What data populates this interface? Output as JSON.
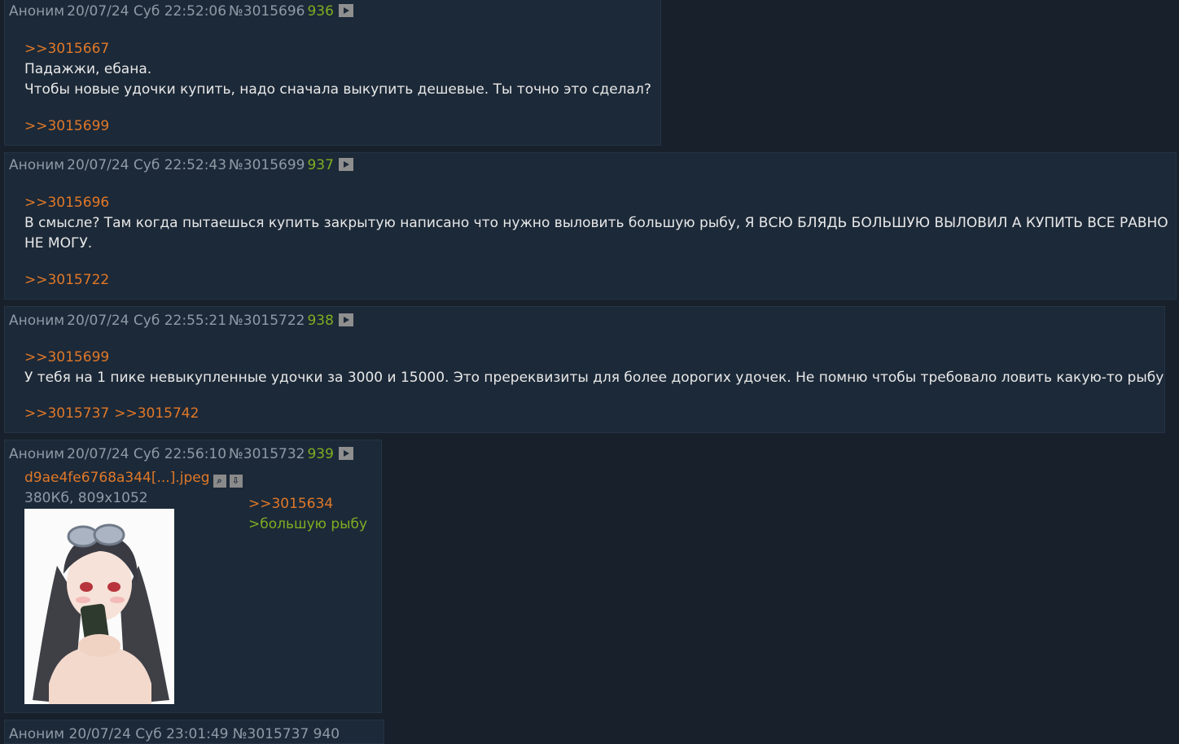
{
  "posts": [
    {
      "author": "Аноним",
      "date": "20/07/24 Суб 22:52:06",
      "id": "№3015696",
      "number": "936",
      "reply_to": ">>3015667",
      "lines": [
        "Падажжи, ебана.",
        "Чтобы новые удочки купить, надо сначала выкупить дешевые. Ты точно это сделал?"
      ],
      "replies": [
        ">>3015699"
      ]
    },
    {
      "author": "Аноним",
      "date": "20/07/24 Суб 22:52:43",
      "id": "№3015699",
      "number": "937",
      "reply_to": ">>3015696",
      "lines": [
        "В смысле? Там когда пытаешься купить закрытую написано что нужно выловить большую рыбу, Я ВСЮ БЛЯДЬ БОЛЬШУЮ ВЫЛОВИЛ А КУПИТЬ ВСЕ РАВНО",
        "НЕ МОГУ."
      ],
      "replies": [
        ">>3015722"
      ]
    },
    {
      "author": "Аноним",
      "date": "20/07/24 Суб 22:55:21",
      "id": "№3015722",
      "number": "938",
      "reply_to": ">>3015699",
      "lines": [
        "У тебя на 1 пике невыкупленные удочки за 3000 и 15000. Это пререквизиты для более дорогих удочек. Не помню чтобы требовало ловить какую-то рыбу"
      ],
      "replies": [
        ">>3015737",
        ">>3015742"
      ]
    },
    {
      "author": "Аноним",
      "date": "20/07/24 Суб 22:56:10",
      "id": "№3015732",
      "number": "939",
      "file_name": "d9ae4fe6768a344[...].jpeg",
      "file_meta": "380Кб, 809x1052",
      "reply_to": ">>3015634",
      "quote": ">большую рыбу"
    }
  ],
  "partial_post": {
    "header": "Аноним 20/07/24 Суб 23:01:49 №3015737 940"
  },
  "colors": {
    "background": "#17202b",
    "post_background": "#1c2938",
    "link": "#e07828",
    "greentext": "#7fae21",
    "meta": "#8f9aa6"
  },
  "icons": [
    "play-icon",
    "search-icon",
    "download-icon"
  ]
}
